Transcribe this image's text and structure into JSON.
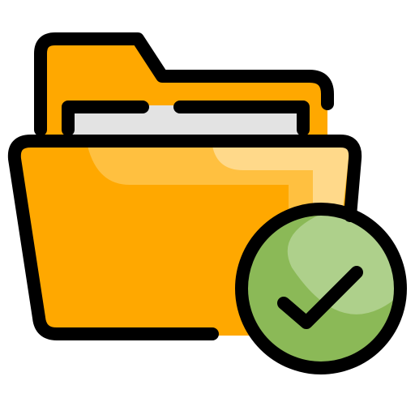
{
  "icon": {
    "name": "folder-check-icon",
    "colors": {
      "folder_back": "#ffa800",
      "folder_front": "#ffa800",
      "folder_highlight": "#ffc040",
      "folder_highlight_light": "#ffd98a",
      "paper": "#e3e3e3",
      "badge_dark": "#8bb957",
      "badge_light": "#aed08b",
      "outline": "#000000"
    }
  }
}
